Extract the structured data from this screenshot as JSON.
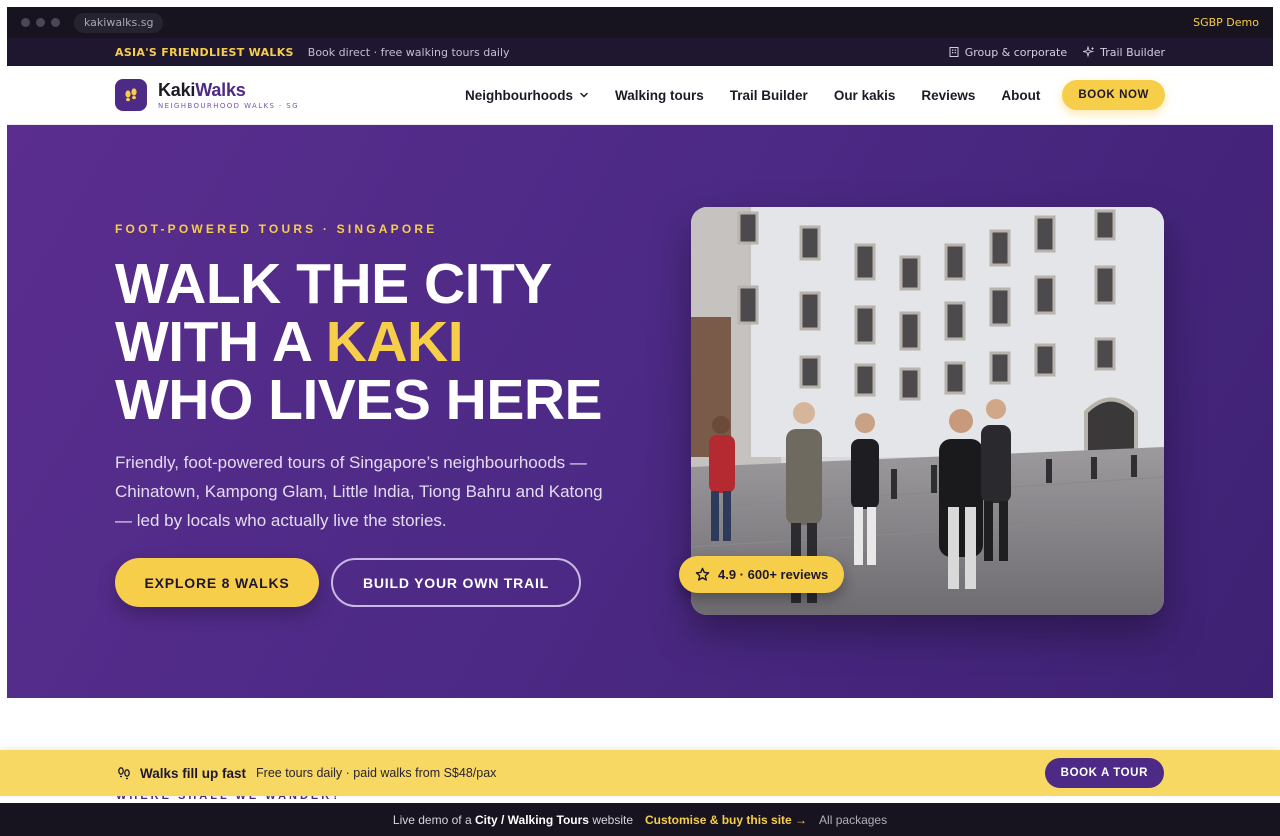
{
  "browser": {
    "url": "kakiwalks.sg",
    "demo_label": "SGBP Demo"
  },
  "topbar": {
    "highlight": "ASIA'S FRIENDLIEST WALKS",
    "subtitle": "Book direct · free walking tours daily",
    "links": [
      {
        "label": "Group & corporate",
        "icon": "building-icon"
      },
      {
        "label": "Trail Builder",
        "icon": "sparkle-icon"
      }
    ]
  },
  "header": {
    "logo": {
      "name_part1": "Kaki",
      "name_part2": "Walks",
      "tagline": "NEIGHBOURHOOD WALKS · SG",
      "icon": "footprints-icon"
    },
    "nav": [
      "Neighbourhoods",
      "Walking tours",
      "Trail Builder",
      "Our kakis",
      "Reviews",
      "About"
    ],
    "cta": "BOOK NOW"
  },
  "hero": {
    "eyebrow": "FOOT-POWERED TOURS · SINGAPORE",
    "headline_line1": "WALK THE CITY",
    "headline_line2_pre": "WITH A ",
    "headline_line2_accent": "KAKI",
    "headline_line3": "WHO LIVES HERE",
    "lede": "Friendly, foot-powered tours of Singapore’s neighbourhoods — Chinatown, Kampong Glam, Little India, Tiong Bahru and Katong — led by locals who actually live the stories.",
    "primary_button": "EXPLORE 8 WALKS",
    "secondary_button": "BUILD YOUR OWN TRAIL",
    "rating": "4.9 · 600+ reviews"
  },
  "section_peek": "WHERE SHALL WE WANDER?",
  "promo": {
    "title": "Walks fill up fast",
    "subtitle": "Free tours daily · paid walks from S$48/pax",
    "button": "BOOK A TOUR"
  },
  "demobar": {
    "prefix": "Live demo of a",
    "category": "City / Walking Tours",
    "suffix": "website",
    "cta": "Customise & buy this site →",
    "link": "All packages"
  },
  "colors": {
    "brand_purple": "#4d2a86",
    "accent_yellow": "#f7ce4a",
    "dark": "#17141f"
  }
}
